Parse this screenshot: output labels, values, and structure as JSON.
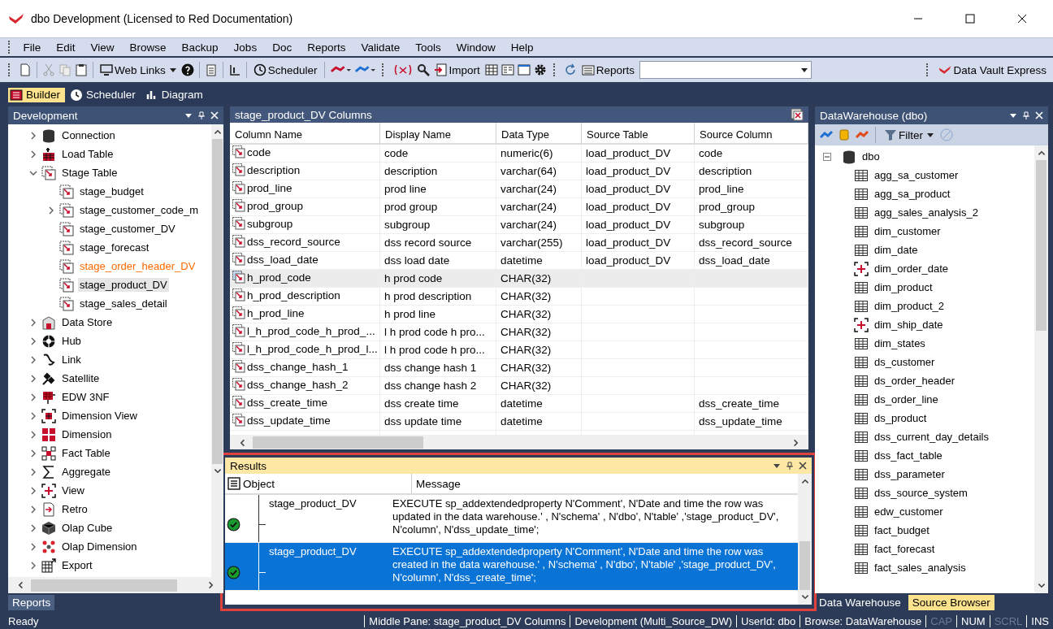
{
  "window": {
    "title": "dbo  Development  (Licensed to Red Documentation)"
  },
  "menu": [
    "File",
    "Edit",
    "View",
    "Browse",
    "Backup",
    "Jobs",
    "Doc",
    "Reports",
    "Validate",
    "Tools",
    "Window",
    "Help"
  ],
  "toolbar": {
    "web_links": "Web Links",
    "scheduler": "Scheduler",
    "import": "Import",
    "reports": "Reports",
    "data_vault_express": "Data Vault Express"
  },
  "view_tabs": [
    {
      "label": "Builder",
      "selected": true,
      "kind": "builder"
    },
    {
      "label": "Scheduler",
      "selected": false,
      "kind": "clock"
    },
    {
      "label": "Diagram",
      "selected": false,
      "kind": "chart"
    }
  ],
  "left_panel": {
    "title": "Development",
    "tree": [
      {
        "label": "Connection",
        "kind": "connection",
        "expanded": false,
        "selected": false,
        "color": "#000000"
      },
      {
        "label": "Load Table",
        "kind": "load",
        "expanded": false,
        "selected": false,
        "color": "#000000"
      },
      {
        "label": "Stage Table",
        "kind": "stage",
        "expanded": true,
        "selected": false,
        "color": "#000000",
        "children": [
          {
            "label": "stage_budget",
            "kind": "stage",
            "selected": false,
            "color": "#000000"
          },
          {
            "label": "stage_customer_code_m",
            "kind": "stage",
            "expanded": false,
            "selected": false,
            "color": "#000000"
          },
          {
            "label": "stage_customer_DV",
            "kind": "stage",
            "selected": false,
            "color": "#000000"
          },
          {
            "label": "stage_forecast",
            "kind": "stage",
            "selected": false,
            "color": "#000000"
          },
          {
            "label": "stage_order_header_DV",
            "kind": "stage",
            "selected": false,
            "color": "#ff6a00"
          },
          {
            "label": "stage_product_DV",
            "kind": "stage",
            "selected": true,
            "color": "#000000"
          },
          {
            "label": "stage_sales_detail",
            "kind": "stage",
            "selected": false,
            "color": "#000000"
          }
        ]
      },
      {
        "label": "Data Store",
        "kind": "datastore",
        "expanded": false,
        "selected": false,
        "color": "#000000"
      },
      {
        "label": "Hub",
        "kind": "hub",
        "expanded": false,
        "selected": false,
        "color": "#000000"
      },
      {
        "label": "Link",
        "kind": "link",
        "expanded": false,
        "selected": false,
        "color": "#000000"
      },
      {
        "label": "Satellite",
        "kind": "satellite",
        "expanded": false,
        "selected": false,
        "color": "#000000"
      },
      {
        "label": "EDW 3NF",
        "kind": "edw",
        "expanded": false,
        "selected": false,
        "color": "#000000"
      },
      {
        "label": "Dimension View",
        "kind": "dimview",
        "expanded": false,
        "selected": false,
        "color": "#000000"
      },
      {
        "label": "Dimension",
        "kind": "dimension",
        "expanded": false,
        "selected": false,
        "color": "#000000"
      },
      {
        "label": "Fact Table",
        "kind": "fact",
        "expanded": false,
        "selected": false,
        "color": "#000000"
      },
      {
        "label": "Aggregate",
        "kind": "aggregate",
        "expanded": false,
        "selected": false,
        "color": "#000000"
      },
      {
        "label": "View",
        "kind": "view",
        "expanded": false,
        "selected": false,
        "color": "#000000"
      },
      {
        "label": "Retro",
        "kind": "retro",
        "expanded": false,
        "selected": false,
        "color": "#000000"
      },
      {
        "label": "Olap Cube",
        "kind": "cube",
        "expanded": false,
        "selected": false,
        "color": "#000000"
      },
      {
        "label": "Olap Dimension",
        "kind": "olapdim",
        "expanded": false,
        "selected": false,
        "color": "#000000"
      },
      {
        "label": "Export",
        "kind": "export",
        "expanded": false,
        "selected": false,
        "color": "#000000"
      }
    ],
    "bottom_tab": "Reports"
  },
  "columns_panel": {
    "title": "stage_product_DV Columns",
    "columns": [
      "Column Name",
      "Display Name",
      "Data Type",
      "Source Table",
      "Source Column"
    ],
    "rows": [
      {
        "cells": [
          "code",
          "code",
          "numeric(6)",
          "load_product_DV",
          "code"
        ],
        "selected": false
      },
      {
        "cells": [
          "description",
          "description",
          "varchar(64)",
          "load_product_DV",
          "description"
        ],
        "selected": false
      },
      {
        "cells": [
          "prod_line",
          "prod line",
          "varchar(24)",
          "load_product_DV",
          "prod_line"
        ],
        "selected": false
      },
      {
        "cells": [
          "prod_group",
          "prod group",
          "varchar(24)",
          "load_product_DV",
          "prod_group"
        ],
        "selected": false
      },
      {
        "cells": [
          "subgroup",
          "subgroup",
          "varchar(24)",
          "load_product_DV",
          "subgroup"
        ],
        "selected": false
      },
      {
        "cells": [
          "dss_record_source",
          "dss record source",
          "varchar(255)",
          "load_product_DV",
          "dss_record_source"
        ],
        "selected": false
      },
      {
        "cells": [
          "dss_load_date",
          "dss load date",
          "datetime",
          "load_product_DV",
          "dss_load_date"
        ],
        "selected": false
      },
      {
        "cells": [
          "h_prod_code",
          "h prod code",
          "CHAR(32)",
          "",
          ""
        ],
        "selected": true
      },
      {
        "cells": [
          "h_prod_description",
          "h prod description",
          "CHAR(32)",
          "",
          ""
        ],
        "selected": false
      },
      {
        "cells": [
          "h_prod_line",
          "h prod line",
          "CHAR(32)",
          "",
          ""
        ],
        "selected": false
      },
      {
        "cells": [
          "l_h_prod_code_h_prod_...",
          "l h prod code h pro...",
          "CHAR(32)",
          "",
          ""
        ],
        "selected": false
      },
      {
        "cells": [
          "l_h_prod_code_h_prod_l...",
          "l h prod code h pro...",
          "CHAR(32)",
          "",
          ""
        ],
        "selected": false
      },
      {
        "cells": [
          "dss_change_hash_1",
          "dss change hash 1",
          "CHAR(32)",
          "",
          ""
        ],
        "selected": false
      },
      {
        "cells": [
          "dss_change_hash_2",
          "dss change hash 2",
          "CHAR(32)",
          "",
          ""
        ],
        "selected": false
      },
      {
        "cells": [
          "dss_create_time",
          "dss create time",
          "datetime",
          "",
          "dss_create_time"
        ],
        "selected": false
      },
      {
        "cells": [
          "dss_update_time",
          "dss update time",
          "datetime",
          "",
          "dss_update_time"
        ],
        "selected": false
      }
    ]
  },
  "results": {
    "title": "Results",
    "columns": [
      "Object",
      "Message"
    ],
    "rows": [
      {
        "object": "stage_product_DV",
        "message": "EXECUTE sp_addextendedproperty N'Comment', N'Date and time the row was updated in the data warehouse.' , N'schema' , N'dbo', N'table' ,'stage_product_DV', N'column', N'dss_update_time';",
        "succeeded": true,
        "selected": false
      },
      {
        "object": "stage_product_DV",
        "message": "EXECUTE sp_addextendedproperty N'Comment', N'Date and time the row was created in the data warehouse.' , N'schema' , N'dbo', N'table' ,'stage_product_DV', N'column', N'dss_create_time';",
        "succeeded": true,
        "selected": true
      }
    ]
  },
  "right_panel": {
    "title": "DataWarehouse (dbo)",
    "filter": "Filter",
    "root": {
      "label": "dbo",
      "expanded": true,
      "children": [
        {
          "label": "agg_sa_customer",
          "kind": "table"
        },
        {
          "label": "agg_sa_product",
          "kind": "table"
        },
        {
          "label": "agg_sales_analysis_2",
          "kind": "table"
        },
        {
          "label": "dim_customer",
          "kind": "table"
        },
        {
          "label": "dim_date",
          "kind": "table"
        },
        {
          "label": "dim_order_date",
          "kind": "view"
        },
        {
          "label": "dim_product",
          "kind": "table"
        },
        {
          "label": "dim_product_2",
          "kind": "table"
        },
        {
          "label": "dim_ship_date",
          "kind": "view"
        },
        {
          "label": "dim_states",
          "kind": "table"
        },
        {
          "label": "ds_customer",
          "kind": "table"
        },
        {
          "label": "ds_order_header",
          "kind": "table"
        },
        {
          "label": "ds_order_line",
          "kind": "table"
        },
        {
          "label": "ds_product",
          "kind": "table"
        },
        {
          "label": "dss_current_day_details",
          "kind": "table"
        },
        {
          "label": "dss_fact_table",
          "kind": "table"
        },
        {
          "label": "dss_parameter",
          "kind": "table"
        },
        {
          "label": "dss_source_system",
          "kind": "table"
        },
        {
          "label": "edw_customer",
          "kind": "table"
        },
        {
          "label": "fact_budget",
          "kind": "table"
        },
        {
          "label": "fact_forecast",
          "kind": "table"
        },
        {
          "label": "fact_sales_analysis",
          "kind": "table"
        }
      ]
    },
    "bottom_tabs": [
      {
        "label": "Data Warehouse",
        "selected": false
      },
      {
        "label": "Source Browser",
        "selected": true
      }
    ]
  },
  "status_bar": {
    "left": "Ready",
    "segments": [
      {
        "text": "Middle Pane: stage_product_DV Columns",
        "disabled": false
      },
      {
        "text": "Development (Multi_Source_DW)",
        "disabled": false
      },
      {
        "text": "UserId: dbo",
        "disabled": false
      },
      {
        "text": "Browse: DataWarehouse",
        "disabled": false
      },
      {
        "text": "CAP",
        "disabled": true
      },
      {
        "text": "NUM",
        "disabled": false
      },
      {
        "text": "SCRL",
        "disabled": true
      },
      {
        "text": "INS",
        "disabled": false
      }
    ]
  }
}
